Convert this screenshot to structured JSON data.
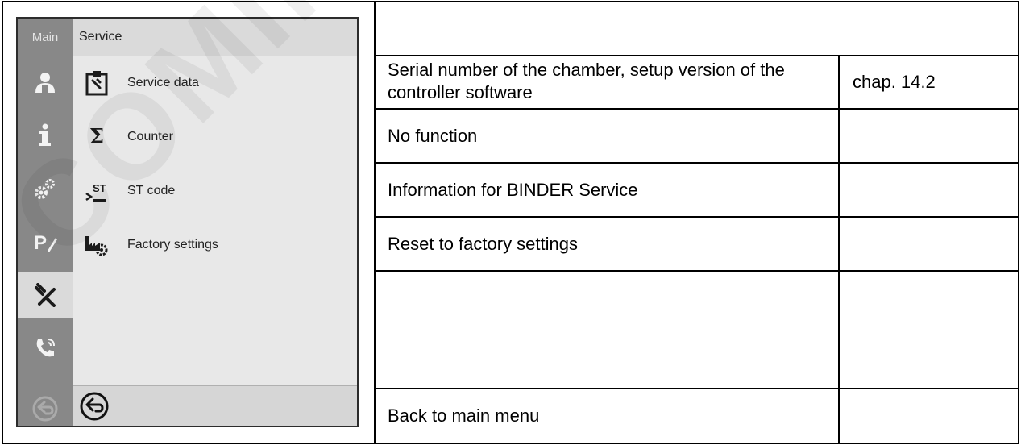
{
  "device": {
    "tab_main": "Main",
    "title": "Service",
    "menu": [
      {
        "label": "Service data",
        "icon": "clipboard-wrench-icon"
      },
      {
        "label": "Counter",
        "icon": "sigma-icon"
      },
      {
        "label": "ST code",
        "icon": "st-code-icon"
      },
      {
        "label": "Factory settings",
        "icon": "factory-gear-icon"
      }
    ],
    "sidebar_icons": [
      "user-icon",
      "info-icon",
      "settings-gears-icon",
      "program-edit-icon",
      "service-tools-icon",
      "phone-support-icon",
      "back-icon"
    ],
    "back_icon": "back-arrow-icon"
  },
  "table": {
    "rows": [
      {
        "description": "",
        "reference": ""
      },
      {
        "description": "Serial number of the chamber, setup version of the controller software",
        "reference": "chap. 14.2"
      },
      {
        "description": "No function",
        "reference": ""
      },
      {
        "description": "Information for BINDER Service",
        "reference": ""
      },
      {
        "description": "Reset to factory settings",
        "reference": ""
      },
      {
        "description": "",
        "reference": ""
      },
      {
        "description": "Back to main menu",
        "reference": ""
      }
    ]
  },
  "watermark": "COMING"
}
